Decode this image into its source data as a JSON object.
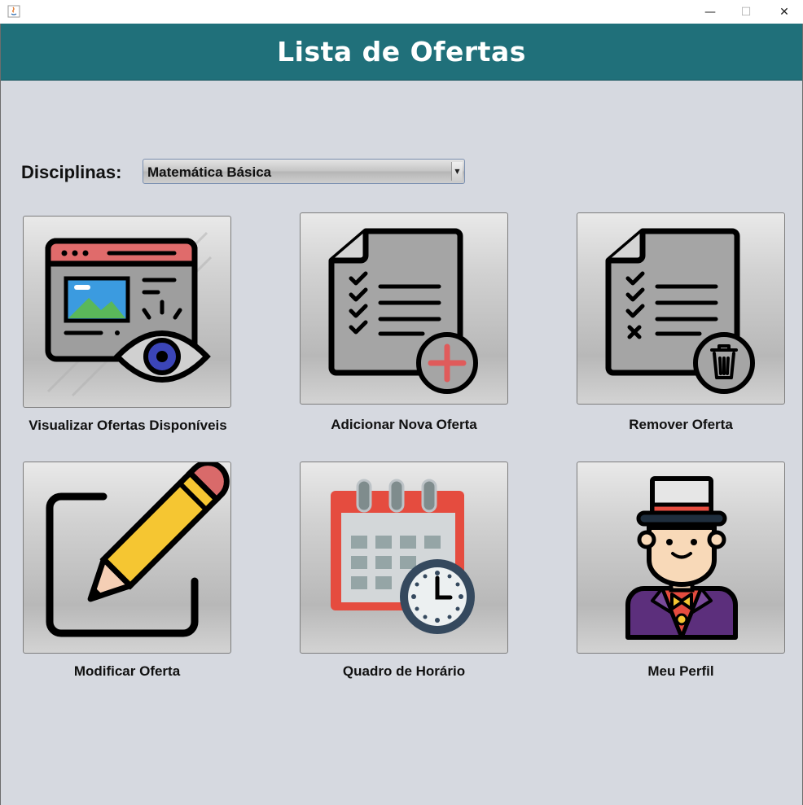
{
  "window": {
    "minimize_glyph": "—",
    "maximize_glyph": "☐",
    "close_glyph": "✕"
  },
  "header": {
    "title": "Lista de Ofertas"
  },
  "filter": {
    "label": "Disciplinas:",
    "selected": "Matemática Básica"
  },
  "tiles": [
    {
      "label": "Visualizar Ofertas Disponíveis",
      "icon": "view-offers-icon"
    },
    {
      "label": "Adicionar Nova Oferta",
      "icon": "add-document-icon"
    },
    {
      "label": "Remover Oferta",
      "icon": "delete-document-icon"
    },
    {
      "label": "Modificar Oferta",
      "icon": "edit-pencil-icon"
    },
    {
      "label": "Quadro de Horário",
      "icon": "calendar-clock-icon"
    },
    {
      "label": "Meu Perfil",
      "icon": "user-profile-icon"
    }
  ],
  "colors": {
    "header_bg": "#20707a",
    "background": "#d6d9e0"
  }
}
